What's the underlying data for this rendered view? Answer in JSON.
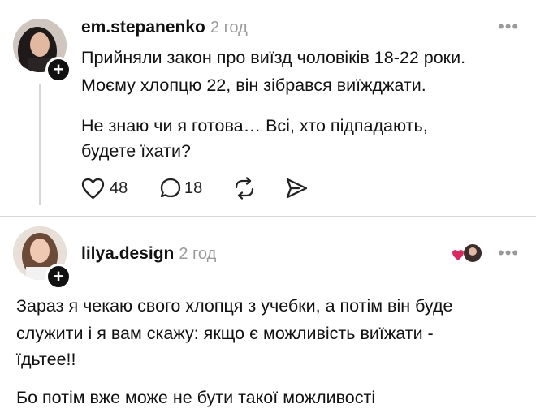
{
  "posts": [
    {
      "username": "em.stepanenko",
      "time": "2 год",
      "paragraphs": [
        "Прийняли закон про виїзд чоловіків 18-22 роки.",
        "Моєму хлопцю 22, він зібрався виїжджати.",
        "Не знаю чи я готова… Всі, хто підпадають,",
        "будете їхати?"
      ],
      "likes": "48",
      "replies": "18"
    },
    {
      "username": "lilya.design",
      "time": "2 год",
      "paragraphs": [
        "Зараз я чекаю свого хлопця з учебки, а потім він буде",
        "служити і я вам скажу: якщо є можливість виїжати -",
        "їдьтее!!",
        "Бо потім вже може не бути такої можливості"
      ]
    }
  ],
  "icons": {
    "more": "more-horizontal-icon",
    "heart": "heart-icon",
    "reply": "speech-bubble-icon",
    "repost": "repost-icon",
    "share": "send-icon"
  },
  "colors": {
    "text": "#111111",
    "muted": "#9a9a9a",
    "like_accent": "#e0245e"
  }
}
